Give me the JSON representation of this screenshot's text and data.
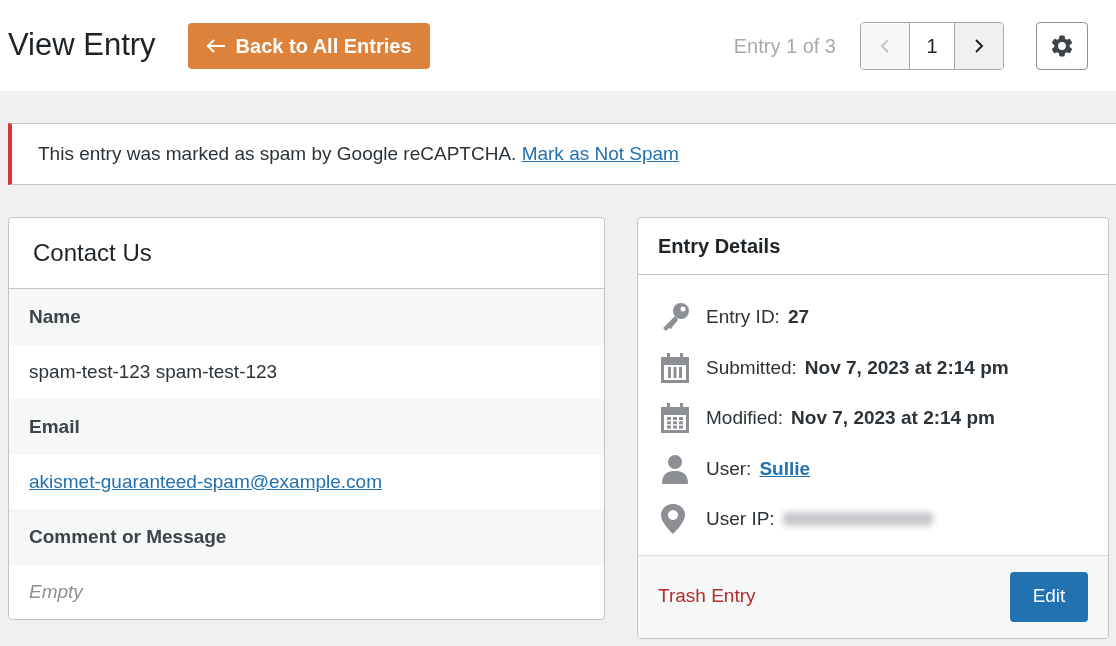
{
  "header": {
    "title": "View Entry",
    "back_button": "Back to All Entries",
    "entry_counter": "Entry 1 of 3",
    "pagination": {
      "prev_disabled": true,
      "current": "1",
      "next_disabled": false
    }
  },
  "notice": {
    "text": "This entry was marked as spam by Google reCAPTCHA.",
    "link": "Mark as Not Spam"
  },
  "form": {
    "title": "Contact Us",
    "fields": [
      {
        "label": "Name",
        "value": "spam-test-123 spam-test-123",
        "kind": "text"
      },
      {
        "label": "Email",
        "value": "akismet-guaranteed-spam@example.com",
        "kind": "link"
      },
      {
        "label": "Comment or Message",
        "value": "Empty",
        "kind": "empty"
      }
    ]
  },
  "details": {
    "title": "Entry Details",
    "items": [
      {
        "kind": "key",
        "label": "Entry ID:",
        "value": {
          "kind": "bold",
          "text": "27"
        }
      },
      {
        "kind": "calendar",
        "label": "Submitted:",
        "value": {
          "kind": "bold",
          "text": "Nov 7, 2023 at 2:14 pm"
        }
      },
      {
        "kind": "calendar-grid",
        "label": "Modified:",
        "value": {
          "kind": "bold",
          "text": "Nov 7, 2023 at 2:14 pm"
        }
      },
      {
        "kind": "person",
        "label": "User:",
        "value": {
          "kind": "link",
          "text": "Sullie"
        }
      },
      {
        "kind": "pin",
        "label": "User IP:",
        "value": {
          "kind": "blurred"
        }
      }
    ],
    "trash_link": "Trash Entry",
    "edit_button": "Edit"
  }
}
